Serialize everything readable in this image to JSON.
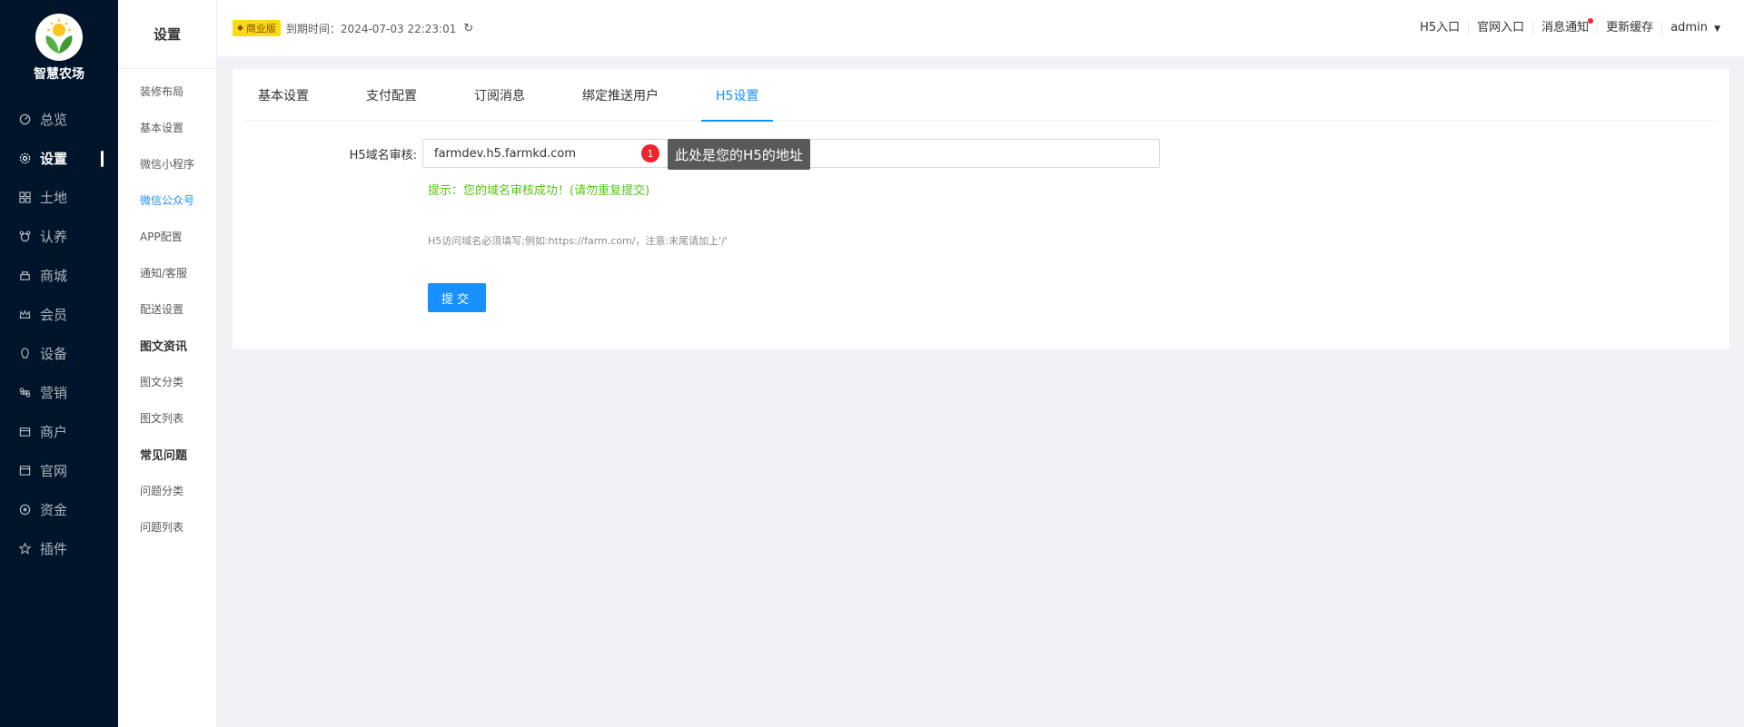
{
  "brand": {
    "name": "智慧农场"
  },
  "main_nav": [
    {
      "label": "总览",
      "icon": "dashboard-icon"
    },
    {
      "label": "设置",
      "icon": "gear-icon",
      "active": true
    },
    {
      "label": "土地",
      "icon": "grid-icon"
    },
    {
      "label": "认养",
      "icon": "adopt-icon"
    },
    {
      "label": "商城",
      "icon": "shop-icon"
    },
    {
      "label": "会员",
      "icon": "crown-icon"
    },
    {
      "label": "设备",
      "icon": "device-icon"
    },
    {
      "label": "营销",
      "icon": "command-icon"
    },
    {
      "label": "商户",
      "icon": "merchant-icon"
    },
    {
      "label": "官网",
      "icon": "website-icon"
    },
    {
      "label": "资金",
      "icon": "coin-icon"
    },
    {
      "label": "插件",
      "icon": "star-icon"
    }
  ],
  "sub_nav": {
    "title": "设置",
    "items": [
      {
        "label": "装修布局",
        "type": "item"
      },
      {
        "label": "基本设置",
        "type": "item"
      },
      {
        "label": "微信小程序",
        "type": "item"
      },
      {
        "label": "微信公众号",
        "type": "item",
        "active": true
      },
      {
        "label": "APP配置",
        "type": "item"
      },
      {
        "label": "通知/客服",
        "type": "item"
      },
      {
        "label": "配送设置",
        "type": "item"
      },
      {
        "label": "图文资讯",
        "type": "group"
      },
      {
        "label": "图文分类",
        "type": "item"
      },
      {
        "label": "图文列表",
        "type": "item"
      },
      {
        "label": "常见问题",
        "type": "group"
      },
      {
        "label": "问题分类",
        "type": "item"
      },
      {
        "label": "问题列表",
        "type": "item"
      }
    ]
  },
  "header": {
    "edition_badge": "商业版",
    "expire_label": "到期时间：2024-07-03 22:23:01",
    "links": [
      "H5入口",
      "官网入口",
      "消息通知",
      "更新缓存"
    ],
    "user": "admin"
  },
  "tabs": [
    {
      "label": "基本设置"
    },
    {
      "label": "支付配置"
    },
    {
      "label": "订阅消息"
    },
    {
      "label": "绑定推送用户"
    },
    {
      "label": "H5设置",
      "active": true
    }
  ],
  "form": {
    "domain_label": "H5域名审核:",
    "domain_value": "farmdev.h5.farmkd.com",
    "success_tip": "提示：您的域名审核成功！(请勿重复提交)",
    "note": "H5访问域名必须填写;例如:https://farm.com/，注意:末尾请加上'/'",
    "submit_label": "提交"
  },
  "annotation": {
    "number": "1",
    "text": "此处是您的H5的地址"
  },
  "colors": {
    "sidebar_bg": "#001529",
    "primary": "#1890ff",
    "success": "#52c41a",
    "badge": "#fadb14"
  }
}
